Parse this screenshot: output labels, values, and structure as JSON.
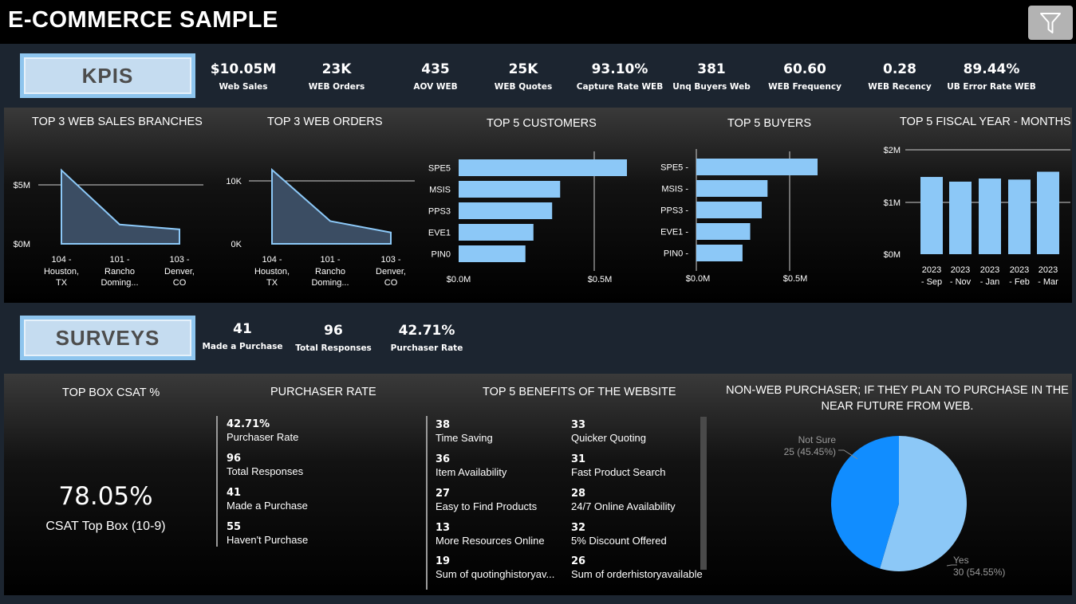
{
  "app": {
    "title": "E-COMMERCE SAMPLE"
  },
  "icons": {
    "filter": "filter-icon"
  },
  "kpis": {
    "label": "KPIS",
    "items": [
      {
        "value": "$10.05M",
        "label": "Web Sales"
      },
      {
        "value": "23K",
        "label": "WEB Orders"
      },
      {
        "value": "435",
        "label": "AOV WEB"
      },
      {
        "value": "25K",
        "label": "WEB Quotes"
      },
      {
        "value": "93.10%",
        "label": "Capture Rate WEB"
      },
      {
        "value": "381",
        "label": "Unq Buyers Web"
      },
      {
        "value": "60.60",
        "label": "WEB Frequency"
      },
      {
        "value": "0.28",
        "label": "WEB Recency"
      },
      {
        "value": "89.44%",
        "label": "UB Error Rate WEB"
      }
    ]
  },
  "charts": {
    "web_sales_branches": {
      "title": "TOP 3 WEB SALES BRANCHES",
      "yticks": [
        "$5M",
        "$0M"
      ],
      "xticks": [
        [
          "104 -",
          "Houston,",
          "TX"
        ],
        [
          "101 -",
          "Rancho",
          "Doming..."
        ],
        [
          "103 -",
          "Denver,",
          "CO"
        ]
      ]
    },
    "web_orders": {
      "title": "TOP 3 WEB ORDERS",
      "yticks": [
        "10K",
        "0K"
      ],
      "xticks": [
        [
          "104 -",
          "Houston,",
          "TX"
        ],
        [
          "101 -",
          "Rancho",
          "Doming..."
        ],
        [
          "103 -",
          "Denver,",
          "CO"
        ]
      ]
    },
    "customers": {
      "title": "TOP 5 CUSTOMERS",
      "xticks": [
        "$0.0M",
        "$0.5M"
      ]
    },
    "buyers": {
      "title": "TOP 5 BUYERS",
      "xticks": [
        "$0.0M",
        "$0.5M"
      ]
    },
    "fiscal_months": {
      "title": "TOP 5 FISCAL YEAR - MONTHS",
      "yticks": [
        "$2M",
        "$1M",
        "$0M"
      ]
    }
  },
  "chart_data": [
    {
      "type": "area",
      "title": "TOP 3 WEB SALES BRANCHES",
      "categories": [
        "104 - Houston, TX",
        "101 - Rancho Doming...",
        "103 - Denver, CO"
      ],
      "values": [
        6100000,
        1600000,
        1200000
      ],
      "ylim": [
        0,
        7000000
      ],
      "grid": true
    },
    {
      "type": "area",
      "title": "TOP 3 WEB ORDERS",
      "categories": [
        "104 - Houston, TX",
        "101 - Rancho Doming...",
        "103 - Denver, CO"
      ],
      "values": [
        13000,
        4000,
        2000
      ],
      "ylim": [
        0,
        14000
      ],
      "grid": true
    },
    {
      "type": "bar",
      "orientation": "horizontal",
      "title": "TOP 5 CUSTOMERS",
      "categories": [
        "SPE5",
        "MSIS",
        "PPS3",
        "EVE1",
        "PIN0"
      ],
      "values": [
        630000,
        380000,
        350000,
        280000,
        250000
      ],
      "xlim": [
        0,
        0.5
      ]
    },
    {
      "type": "bar",
      "orientation": "horizontal",
      "title": "TOP 5 BUYERS",
      "categories": [
        "SPE5",
        "MSIS",
        "PPS3",
        "EVE1",
        "PIN0"
      ],
      "values": [
        630000,
        370000,
        340000,
        280000,
        240000
      ]
    },
    {
      "type": "bar",
      "title": "TOP 5 FISCAL YEAR - MONTHS",
      "categories": [
        "2023 - Sep",
        "2023 - Nov",
        "2023 - Jan",
        "2023 - Feb",
        "2023 - Mar"
      ],
      "values": [
        1480000,
        1390000,
        1450000,
        1430000,
        1580000
      ],
      "ylim": [
        0,
        2000000
      ],
      "grid": true
    },
    {
      "type": "pie",
      "title": "NON-WEB PURCHASER; IF THEY PLAN TO PURCHASE IN THE NEAR FUTURE FROM WEB.",
      "categories": [
        "Not Sure",
        "Yes"
      ],
      "values": [
        25,
        30
      ],
      "labels": [
        "25 (45.45%)",
        "30 (54.55%)"
      ],
      "colors": [
        "#118dff",
        "#8cc8f7"
      ]
    }
  ],
  "surveys": {
    "label": "SURVEYS",
    "items": [
      {
        "value": "41",
        "label": "Made a Purchase"
      },
      {
        "value": "96",
        "label": "Total Responses"
      },
      {
        "value": "42.71%",
        "label": "Purchaser Rate"
      }
    ]
  },
  "csat": {
    "title": "TOP BOX CSAT %",
    "value": "78.05%",
    "label": "CSAT Top Box (10-9)"
  },
  "purchaser": {
    "title": "PURCHASER RATE",
    "items": [
      {
        "value": "42.71%",
        "label": "Purchaser Rate"
      },
      {
        "value": "96",
        "label": "Total Responses"
      },
      {
        "value": "41",
        "label": "Made a Purchase"
      },
      {
        "value": "55",
        "label": "Haven't Purchase"
      }
    ]
  },
  "benefits": {
    "title": "TOP 5 BENEFITS OF THE WEBSITE",
    "col1": [
      {
        "value": "38",
        "label": "Time Saving"
      },
      {
        "value": "36",
        "label": "Item Availability"
      },
      {
        "value": "27",
        "label": "Easy to Find Products"
      },
      {
        "value": "13",
        "label": "More Resources Online"
      },
      {
        "value": "19",
        "label": "Sum of quotinghistoryav..."
      }
    ],
    "col2": [
      {
        "value": "33",
        "label": "Quicker Quoting"
      },
      {
        "value": "31",
        "label": "Fast Product Search"
      },
      {
        "value": "28",
        "label": "24/7 Online Availability"
      },
      {
        "value": "32",
        "label": "5% Discount Offered"
      },
      {
        "value": "26",
        "label": "Sum of orderhistoryavailable"
      }
    ]
  },
  "nonweb": {
    "title": "NON-WEB PURCHASER; IF THEY PLAN TO PURCHASE IN THE NEAR FUTURE FROM WEB.",
    "not_sure_label": "Not Sure",
    "not_sure_value": "25 (45.45%)",
    "yes_label": "Yes",
    "yes_value": "30 (54.55%)"
  },
  "colors": {
    "bar": "#8cc8f7",
    "area": "#3b4d63",
    "area_line": "#8cc8f7",
    "pie_dark": "#118dff",
    "pie_light": "#8cc8f7",
    "label_band": "#c5dcf0"
  }
}
